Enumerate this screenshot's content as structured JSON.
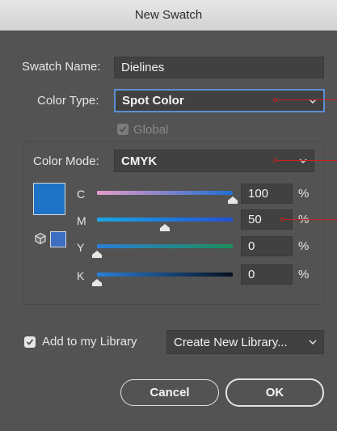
{
  "window": {
    "title": "New Swatch"
  },
  "swatch_name": {
    "label": "Swatch Name:",
    "value": "Dielines"
  },
  "color_type": {
    "label": "Color Type:",
    "value": "Spot Color"
  },
  "global": {
    "label": "Global",
    "checked": true,
    "enabled": false
  },
  "color_mode": {
    "label": "Color Mode:",
    "value": "CMYK"
  },
  "channels": [
    {
      "label": "C",
      "value": "100",
      "unit": "%",
      "level": 100,
      "colors": [
        "#e79bc8",
        "#1f6fd0"
      ]
    },
    {
      "label": "M",
      "value": "50",
      "unit": "%",
      "level": 50,
      "colors": [
        "#1aa7e4",
        "#2452d4"
      ]
    },
    {
      "label": "Y",
      "value": "0",
      "unit": "%",
      "level": 0,
      "colors": [
        "#2a7fd8",
        "#1c8f5a"
      ]
    },
    {
      "label": "K",
      "value": "0",
      "unit": "%",
      "level": 0,
      "colors": [
        "#2a7fd8",
        "#061020"
      ]
    }
  ],
  "colors": {
    "swatch": "#1e73c7",
    "swatch_small": "#3d6ec2",
    "callout": "#cc1e1e"
  },
  "library": {
    "label": "Add to my Library",
    "checked": true,
    "select_value": "Create New Library..."
  },
  "buttons": {
    "cancel": "Cancel",
    "ok": "OK"
  }
}
